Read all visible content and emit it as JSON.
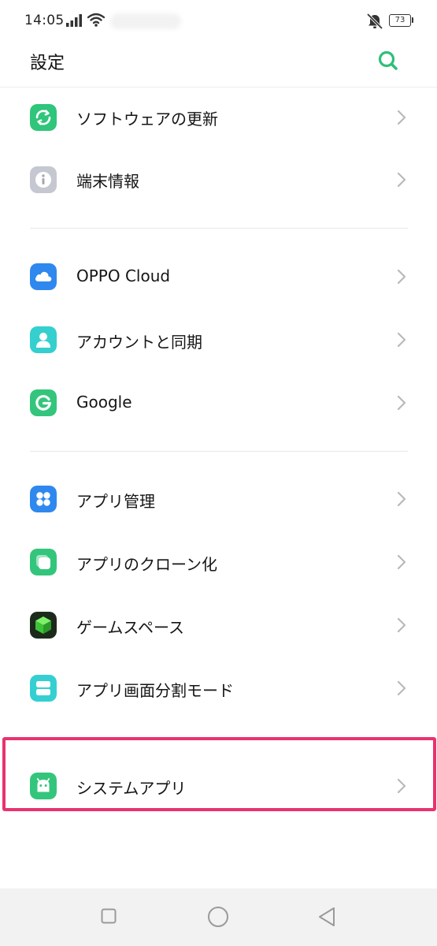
{
  "status_bar": {
    "time": "14:05",
    "battery": "73"
  },
  "header": {
    "title": "設定"
  },
  "colors": {
    "accent": "#2fbf78",
    "highlight": "#e8336e"
  },
  "sections": [
    {
      "items": [
        {
          "label": "ソフトウェアの更新",
          "icon": "software-update-icon",
          "icon_color": "#2fc57a"
        },
        {
          "label": "端末情報",
          "icon": "info-icon",
          "icon_color": "#c5c8d0"
        }
      ]
    },
    {
      "items": [
        {
          "label": "OPPO Cloud",
          "icon": "cloud-icon",
          "icon_color": "#2f88ee"
        },
        {
          "label": "アカウントと同期",
          "icon": "account-icon",
          "icon_color": "#35cfcf"
        },
        {
          "label": "Google",
          "icon": "google-icon",
          "icon_color": "#34c57c"
        }
      ]
    },
    {
      "items": [
        {
          "label": "アプリ管理",
          "icon": "app-management-icon",
          "icon_color": "#2f88ee"
        },
        {
          "label": "アプリのクローン化",
          "icon": "app-clone-icon",
          "icon_color": "#34c57c"
        },
        {
          "label": "ゲームスペース",
          "icon": "game-space-icon",
          "icon_color": "#1c2a1c"
        },
        {
          "label": "アプリ画面分割モード",
          "icon": "split-screen-icon",
          "icon_color": "#35cfd2"
        }
      ]
    },
    {
      "items": [
        {
          "label": "システムアプリ",
          "icon": "android-icon",
          "icon_color": "#34c57c"
        }
      ]
    }
  ],
  "nav_bar": {
    "recents": "recents-icon",
    "home": "home-icon",
    "back": "back-icon"
  }
}
